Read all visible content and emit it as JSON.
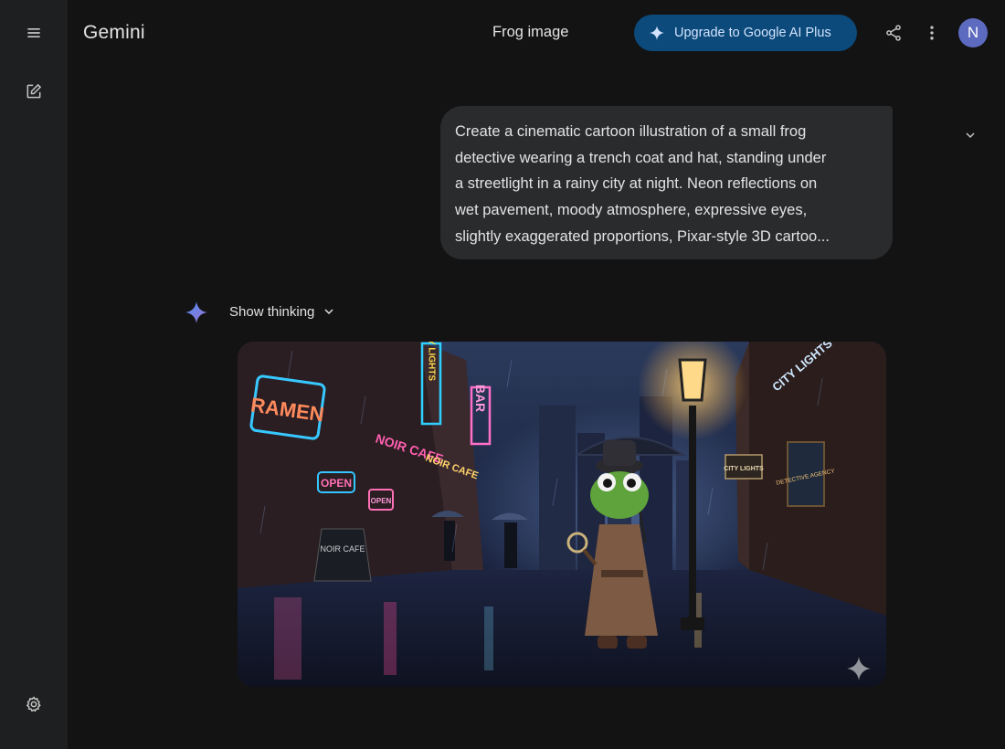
{
  "app": {
    "name": "Gemini"
  },
  "header": {
    "chat_title": "Frog image",
    "upgrade_label": "Upgrade to Google AI Plus",
    "avatar_initial": "N"
  },
  "sidebar": {
    "icons": [
      "menu-icon",
      "edit-square-icon",
      "settings-gear-icon"
    ]
  },
  "conversation": {
    "user_prompt": "Create a cinematic cartoon illustration of a small frog detective wearing a trench coat and hat, standing under a streetlight in a rainy city at night. Neon reflections on wet pavement, moody atmosphere, expressive eyes, slightly exaggerated proportions, Pixar-style 3D cartoo...",
    "show_thinking_label": "Show thinking"
  },
  "generated_image": {
    "neon_signs": {
      "ramen": "RAMEN",
      "city_lights_vertical": "CITY LIGHTS",
      "bar": "BAR",
      "noir_cafe": "NOIR CAFE",
      "open_1": "OPEN",
      "open_2": "OPEN",
      "noir_cafe_2": "NOIR CAFE",
      "city_lights_right": "CITY LIGHTS",
      "city_lights_sign": "CITY LIGHTS",
      "detective_agency": "DETECTIVE AGENCY",
      "sidewalk_sign": "NOIR CAFE"
    }
  },
  "colors": {
    "background": "#131314",
    "rail": "#1e1f20",
    "prompt_bubble": "#2a2b2d",
    "upgrade_button": "#0b4a7a",
    "avatar": "#5c6bc0"
  }
}
